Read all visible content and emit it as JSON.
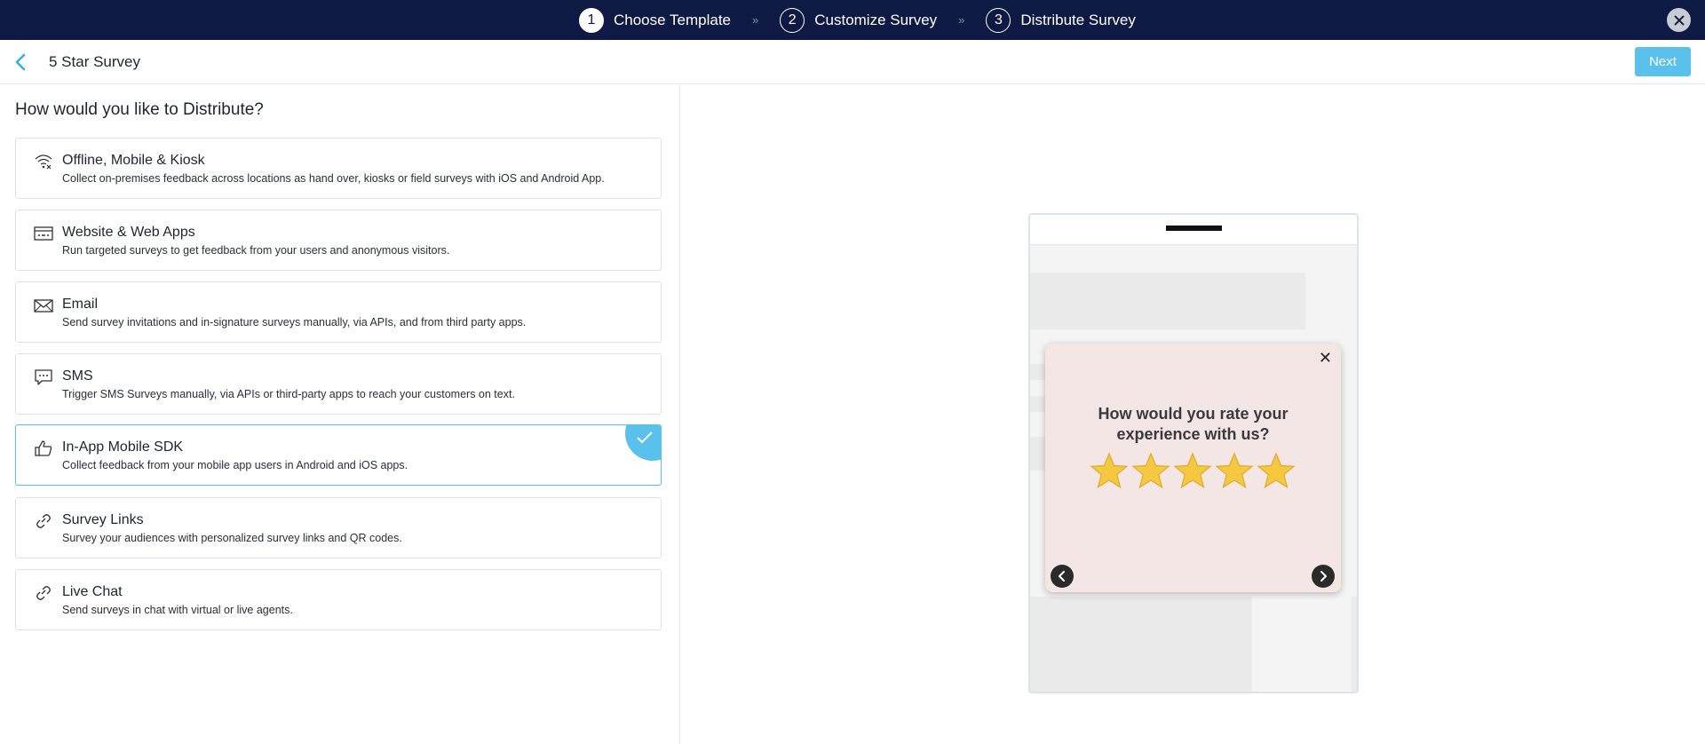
{
  "stepper": {
    "steps": [
      {
        "num": "1",
        "label": "Choose Template"
      },
      {
        "num": "2",
        "label": "Customize Survey"
      },
      {
        "num": "3",
        "label": "Distribute Survey"
      }
    ],
    "separator": "»",
    "close_icon": "close-icon"
  },
  "header": {
    "title": "5 Star Survey",
    "next_label": "Next",
    "back_icon": "chevron-left-icon"
  },
  "distribute": {
    "heading": "How would you like to Distribute?",
    "options": [
      {
        "title": "Offline, Mobile & Kiosk",
        "desc": "Collect on-premises feedback across locations as hand over, kiosks or field surveys with iOS and Android App.",
        "icon": "wifi-off-icon",
        "selected": false
      },
      {
        "title": "Website & Web Apps",
        "desc": "Run targeted surveys to get feedback from your users and anonymous visitors.",
        "icon": "browser-window-icon",
        "selected": false
      },
      {
        "title": "Email",
        "desc": "Send survey invitations and in-signature surveys manually, via APIs, and from third party apps.",
        "icon": "envelope-icon",
        "selected": false
      },
      {
        "title": "SMS",
        "desc": "Trigger SMS Surveys manually, via APIs or third-party apps to reach your customers on text.",
        "icon": "chat-bubble-icon",
        "selected": false
      },
      {
        "title": "In-App Mobile SDK",
        "desc": "Collect feedback from your mobile app users in Android and iOS apps.",
        "icon": "thumbs-up-icon",
        "selected": true
      },
      {
        "title": "Survey Links",
        "desc": "Survey your audiences with personalized survey links and QR codes.",
        "icon": "link-icon",
        "selected": false
      },
      {
        "title": "Live Chat",
        "desc": "Send surveys in chat with virtual or live agents.",
        "icon": "link-icon",
        "selected": false
      }
    ]
  },
  "preview": {
    "question": "How would you rate your experience with us?",
    "close_glyph": "✕",
    "stars_count": 5,
    "star_color": "#f5c842"
  },
  "colors": {
    "topbar": "#0e1a44",
    "accent": "#59c1ec",
    "popup_bg": "#f3e6e4"
  }
}
